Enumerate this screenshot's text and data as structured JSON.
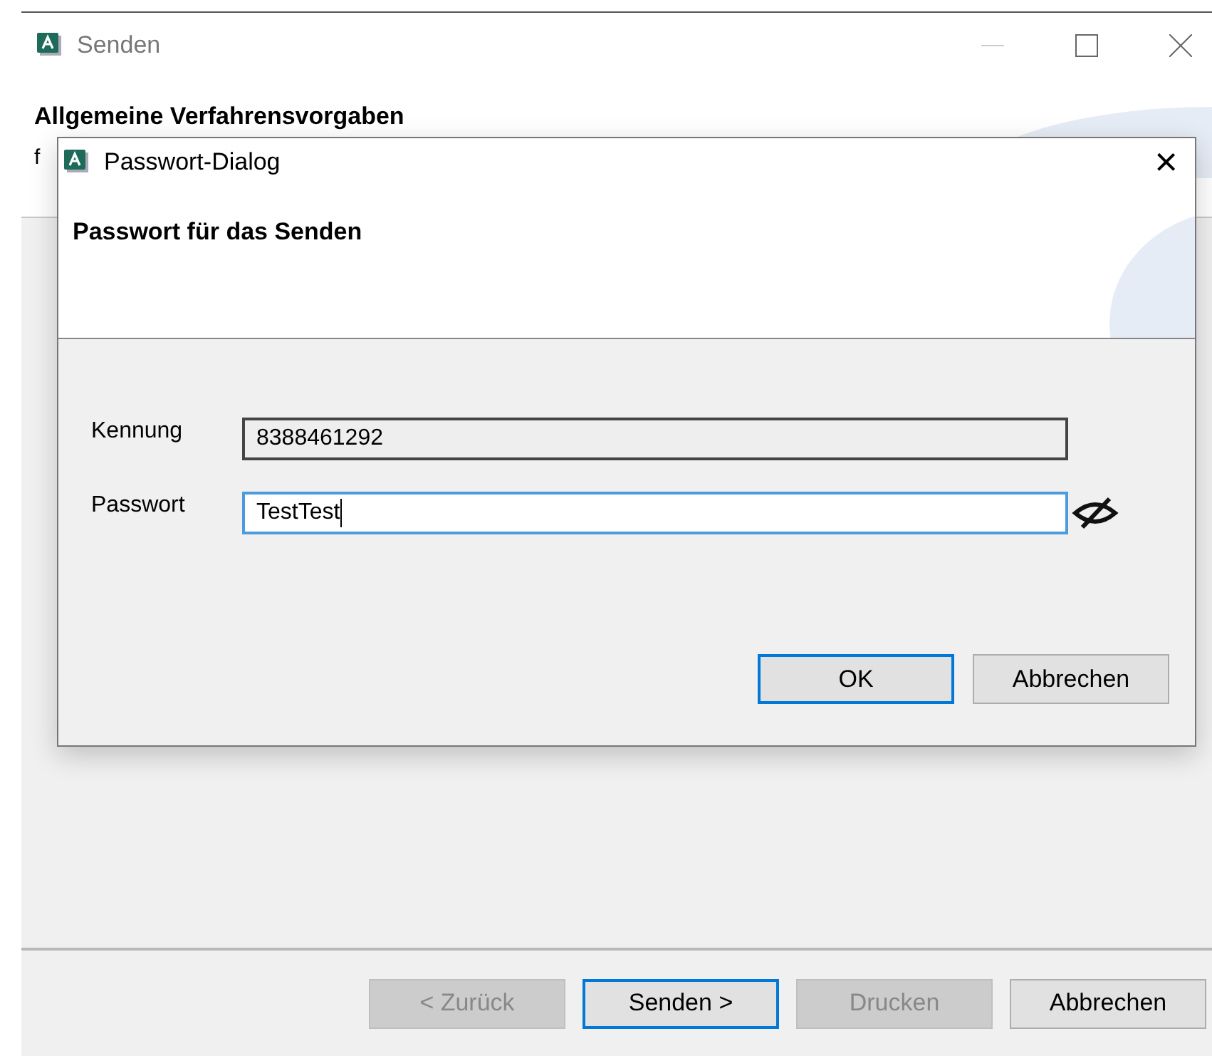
{
  "window": {
    "title": "Senden",
    "heading": "Allgemeine Verfahrensvorgaben",
    "subtitle": "f"
  },
  "wizard_buttons": [
    {
      "label": "< Zurück",
      "disabled": true,
      "default": false
    },
    {
      "label": "Senden >",
      "disabled": false,
      "default": true
    },
    {
      "label": "Drucken",
      "disabled": true,
      "default": false
    },
    {
      "label": "Abbrechen",
      "disabled": false,
      "default": false
    }
  ],
  "dialog": {
    "title": "Passwort-Dialog",
    "close": "×",
    "heading": "Passwort für das Senden",
    "fields": [
      {
        "label": "Kennung",
        "value": "8388461292",
        "kind": "readonly",
        "focused": false
      },
      {
        "label": "Passwort",
        "value": "TestTest",
        "kind": "password",
        "focused": true
      }
    ],
    "buttons": [
      {
        "label": "OK",
        "default": true
      },
      {
        "label": "Abbrechen",
        "default": false
      }
    ]
  }
}
